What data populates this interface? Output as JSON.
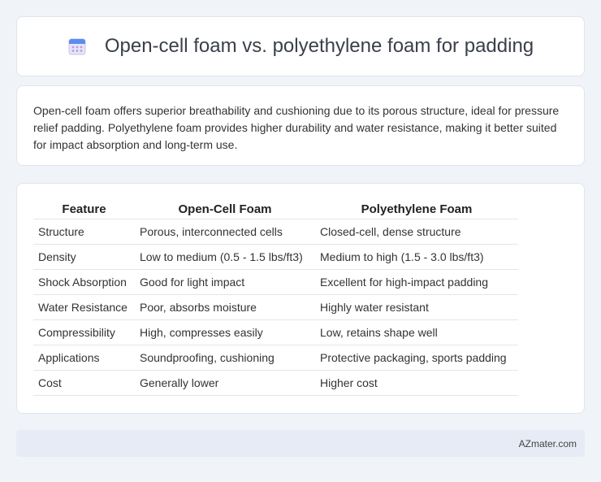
{
  "header": {
    "title": "Open-cell foam vs. polyethylene foam for padding",
    "icon": "calendar-icon"
  },
  "summary": {
    "text": "Open-cell foam offers superior breathability and cushioning due to its porous structure, ideal for pressure relief padding. Polyethylene foam provides higher durability and water resistance, making it better suited for impact absorption and long-term use."
  },
  "table": {
    "headers": [
      "Feature",
      "Open-Cell Foam",
      "Polyethylene Foam"
    ],
    "rows": [
      [
        "Structure",
        "Porous, interconnected cells",
        "Closed-cell, dense structure"
      ],
      [
        "Density",
        "Low to medium (0.5 - 1.5 lbs/ft3)",
        "Medium to high (1.5 - 3.0 lbs/ft3)"
      ],
      [
        "Shock Absorption",
        "Good for light impact",
        "Excellent for high-impact padding"
      ],
      [
        "Water Resistance",
        "Poor, absorbs moisture",
        "Highly water resistant"
      ],
      [
        "Compressibility",
        "High, compresses easily",
        "Low, retains shape well"
      ],
      [
        "Applications",
        "Soundproofing, cushioning",
        "Protective packaging, sports padding"
      ],
      [
        "Cost",
        "Generally lower",
        "Higher cost"
      ]
    ]
  },
  "footer": {
    "brand": "AZmater.com"
  }
}
